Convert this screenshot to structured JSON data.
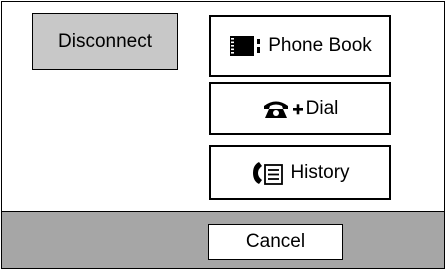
{
  "menu": {
    "disconnect_label": "Disconnect",
    "phonebook_label": "Phone Book",
    "dial_label": "Dial",
    "history_label": "History"
  },
  "footer": {
    "cancel_label": "Cancel"
  },
  "icons": {
    "phonebook": "book-icon",
    "dial": "phone-plus-icon",
    "history": "phone-list-icon"
  },
  "colors": {
    "selected_button_bg": "#c8c8c8",
    "footer_bg": "#a6a6a6"
  }
}
